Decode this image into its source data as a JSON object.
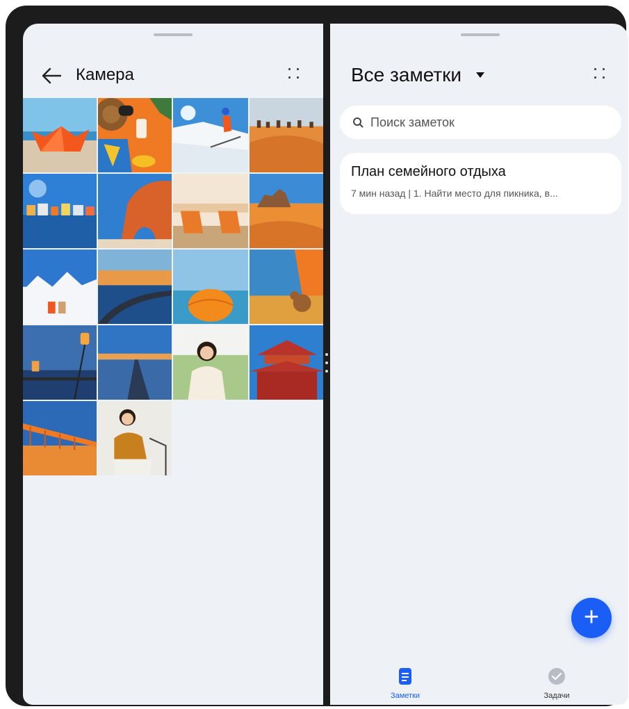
{
  "left_panel": {
    "title": "Камера",
    "back_icon": "arrow-left-icon",
    "menu_icon": "four-dots-icon",
    "photos": [
      {
        "subject": "paper-boat-beach"
      },
      {
        "subject": "beach-accessories"
      },
      {
        "subject": "skier-snow"
      },
      {
        "subject": "desert-camels"
      },
      {
        "subject": "lake-houses"
      },
      {
        "subject": "rock-arch-beach"
      },
      {
        "subject": "beach-chairs"
      },
      {
        "subject": "desert-rocks"
      },
      {
        "subject": "snow-mountains-couple"
      },
      {
        "subject": "road-lake-sunset"
      },
      {
        "subject": "beach-ball-sea"
      },
      {
        "subject": "tent-teddy-bear"
      },
      {
        "subject": "lamp-lake-dusk"
      },
      {
        "subject": "road-horizon"
      },
      {
        "subject": "woman-sofa"
      },
      {
        "subject": "chinese-temple"
      },
      {
        "subject": "bridge-sunset"
      },
      {
        "subject": "woman-chair"
      }
    ]
  },
  "right_panel": {
    "title": "Все заметки",
    "menu_icon": "four-dots-icon",
    "search": {
      "placeholder": "Поиск заметок"
    },
    "notes": [
      {
        "title": "План семейного отдыха",
        "meta": "7 мин назад  |  1. Найти место для пикника, в..."
      }
    ],
    "fab_icon": "plus-icon",
    "bottom_nav": [
      {
        "label": "Заметки",
        "icon": "note-icon",
        "active": true
      },
      {
        "label": "Задачи",
        "icon": "check-circle-icon",
        "active": false
      }
    ]
  },
  "colors": {
    "accent": "#1a5ef5",
    "pane_bg": "#eef1f5",
    "frame": "#1c1c1c"
  }
}
